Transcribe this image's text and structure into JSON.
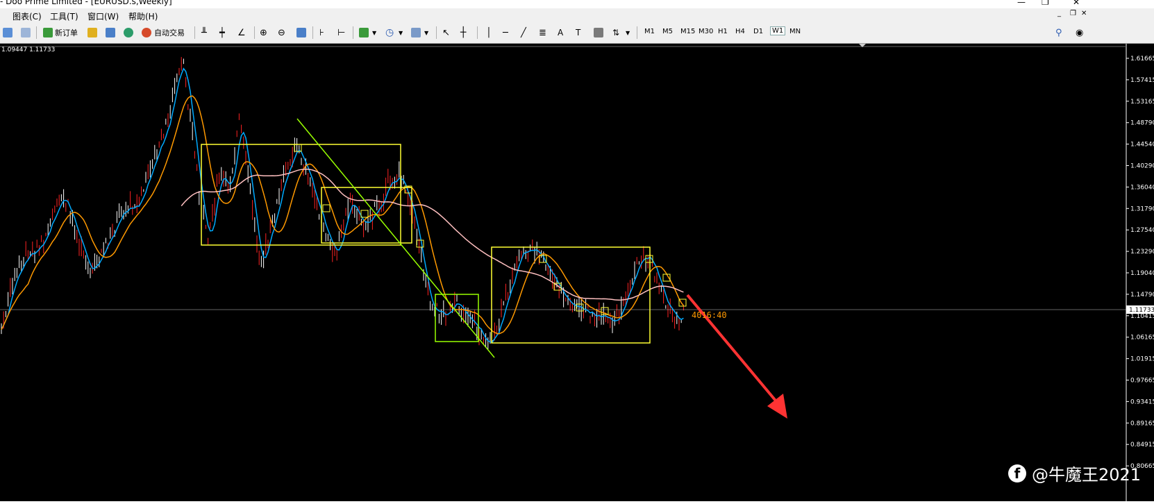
{
  "window": {
    "title": "- Doo Prime Limited - [EURUSD.s,Weekly]"
  },
  "menu": {
    "items": [
      "图表(C)",
      "工具(T)",
      "窗口(W)",
      "帮助(H)"
    ]
  },
  "toolbar": {
    "new_order": "新订单",
    "auto_trade": "自动交易",
    "timeframes": [
      "M1",
      "M5",
      "M15",
      "M30",
      "H1",
      "H4",
      "D1",
      "W1",
      "MN"
    ],
    "active_timeframe": "W1"
  },
  "chart": {
    "symbol": "EURUSD.s",
    "period": "Weekly",
    "ohlc_text": "1.09447 1.11733",
    "current_price": "1.11733",
    "countdown": "4016:40",
    "price_axis": [
      "1.61665",
      "1.57415",
      "1.53165",
      "1.48790",
      "1.44540",
      "1.40290",
      "1.36040",
      "1.31790",
      "1.27540",
      "1.23290",
      "1.19040",
      "1.14790",
      "1.10415",
      "1.06165",
      "1.01915",
      "0.97665",
      "0.93415",
      "0.89165",
      "0.84915",
      "0.80665"
    ],
    "colors": {
      "background": "#000000",
      "bull_candle": "#ffffff",
      "bear_candle": "#ff2222",
      "ma_fast": "#00aaff",
      "ma_mid": "#ff9900",
      "ma_slow": "#ffc0c0",
      "box": "#ffff33",
      "trendline": "#99ff00",
      "arrow": "#ff3333"
    }
  },
  "watermark": {
    "text": "@牛魔王2021",
    "icon": "facebook-icon"
  }
}
